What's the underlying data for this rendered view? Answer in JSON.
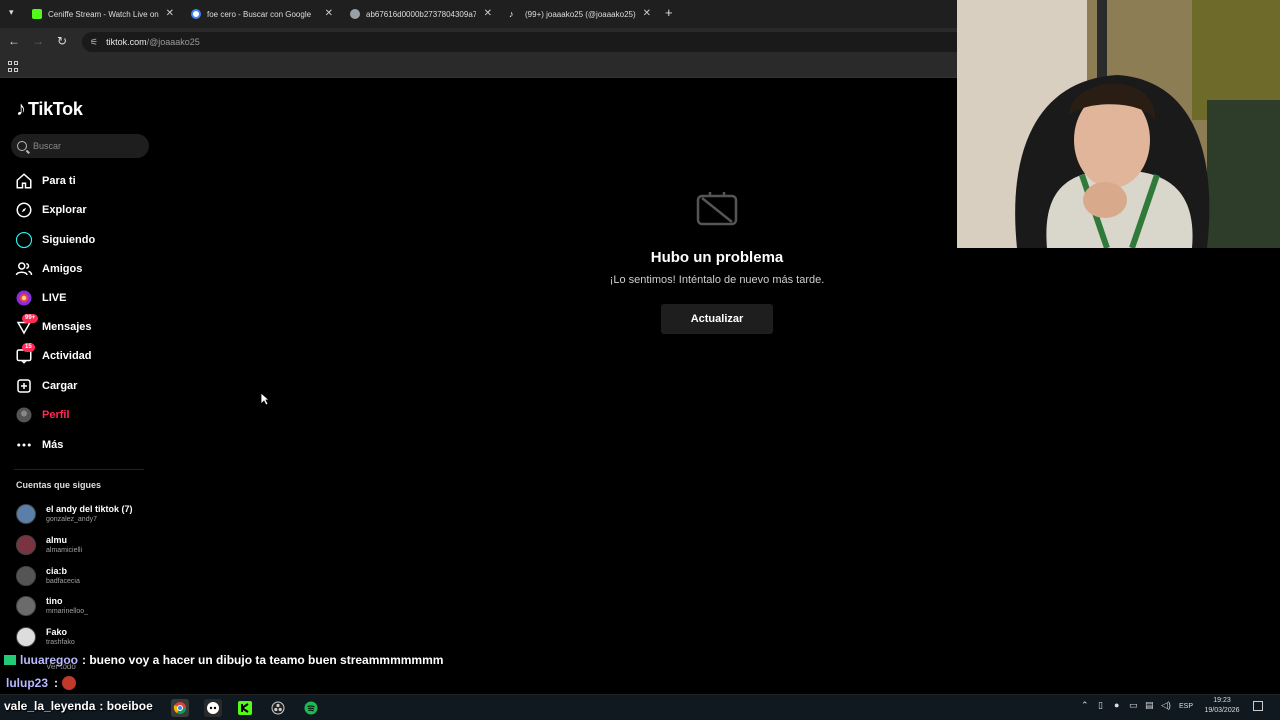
{
  "browser": {
    "tabs": [
      {
        "label": "Ceniffe Stream - Watch Live on",
        "favicon_color": "#53fc18"
      },
      {
        "label": "foe cero - Buscar con Google",
        "favicon_color": "#4285f4"
      },
      {
        "label": "ab67616d0000b2737804309a7",
        "favicon_color": "#9aa0a6"
      },
      {
        "label": "(99+) joaaako25 (@joaaako25) |",
        "favicon_color": "#ffffff"
      }
    ],
    "url_host": "tiktok.com",
    "url_path": "/@joaaako25"
  },
  "tiktok": {
    "logo_text": "TikTok",
    "search_placeholder": "Buscar",
    "nav": [
      {
        "label": "Para ti",
        "icon": "home-icon"
      },
      {
        "label": "Explorar",
        "icon": "compass-icon"
      },
      {
        "label": "Siguiendo",
        "icon": "following-icon"
      },
      {
        "label": "Amigos",
        "icon": "friends-icon"
      },
      {
        "label": "LIVE",
        "icon": "live-icon"
      },
      {
        "label": "Mensajes",
        "icon": "messages-icon",
        "badge": "99+"
      },
      {
        "label": "Actividad",
        "icon": "activity-icon",
        "badge": "15"
      },
      {
        "label": "Cargar",
        "icon": "upload-icon"
      },
      {
        "label": "Perfil",
        "icon": "profile-icon",
        "active": true
      },
      {
        "label": "Más",
        "icon": "more-icon"
      }
    ],
    "following_title": "Cuentas que sigues",
    "following": [
      {
        "name": "el andy del tiktok (7)",
        "user": "gonzalez_andy7",
        "color": "#5a7fa8"
      },
      {
        "name": "almu",
        "user": "almamicielli",
        "color": "#7a3340"
      },
      {
        "name": "cia:b",
        "user": "badfacecia",
        "color": "#555555"
      },
      {
        "name": "tino",
        "user": "mmarinelloo_",
        "color": "#6b6b6b"
      },
      {
        "name": "Fako",
        "user": "trashfako",
        "color": "#dddddd"
      }
    ],
    "see_all": "Ver todo",
    "error": {
      "title": "Hubo un problema",
      "subtitle": "¡Lo sentimos! Inténtalo de nuevo más tarde.",
      "button": "Actualizar"
    }
  },
  "chat": [
    {
      "user": "luuaregoo",
      "message": ": bueno voy a hacer un dibujo ta teamo buen streammmmmmm"
    },
    {
      "user": "lulup23",
      "message": ":"
    },
    {
      "user": "vale_la_leyenda",
      "message": ": boeiboe"
    }
  ],
  "taskbar": {
    "lang": "ESP",
    "time": "19:23",
    "date": "19/03/2026"
  }
}
